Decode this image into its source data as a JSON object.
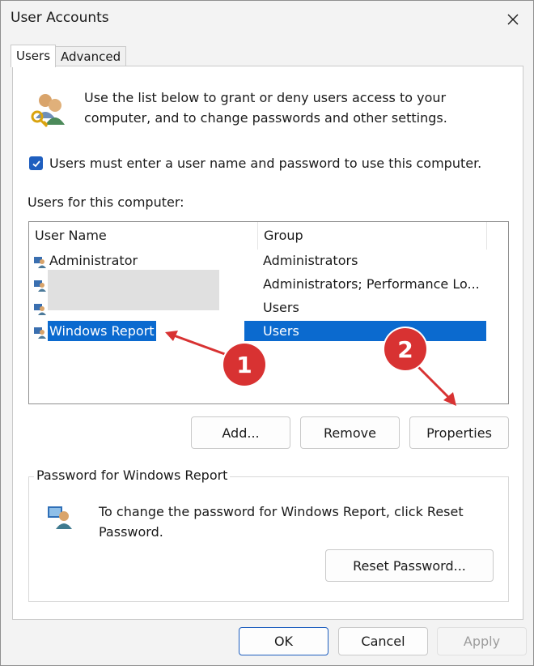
{
  "window": {
    "title": "User Accounts"
  },
  "tabs": [
    {
      "label": "Users",
      "active": true
    },
    {
      "label": "Advanced",
      "active": false
    }
  ],
  "description": "Use the list below to grant or deny users access to your computer, and to change passwords and other settings.",
  "checkbox": {
    "label": "Users must enter a user name and password to use this computer.",
    "checked": true
  },
  "users_label": "Users for this computer:",
  "list": {
    "columns": [
      "User Name",
      "Group"
    ],
    "rows": [
      {
        "name": "Administrator",
        "group": "Administrators"
      },
      {
        "name": "",
        "group": "Administrators; Performance Lo..."
      },
      {
        "name": "",
        "group": "Users"
      },
      {
        "name": "Windows Report",
        "group": "Users"
      }
    ],
    "selected_index": 3
  },
  "buttons": {
    "add": "Add...",
    "remove": "Remove",
    "properties": "Properties"
  },
  "password_group": {
    "title": "Password for Windows Report",
    "text": "To change the password for Windows Report, click Reset Password.",
    "reset_button": "Reset Password..."
  },
  "footer": {
    "ok": "OK",
    "cancel": "Cancel",
    "apply": "Apply"
  },
  "annotations": [
    {
      "label": "1"
    },
    {
      "label": "2"
    }
  ],
  "colors": {
    "accent": "#0b6acf",
    "annotation": "#d83232"
  }
}
